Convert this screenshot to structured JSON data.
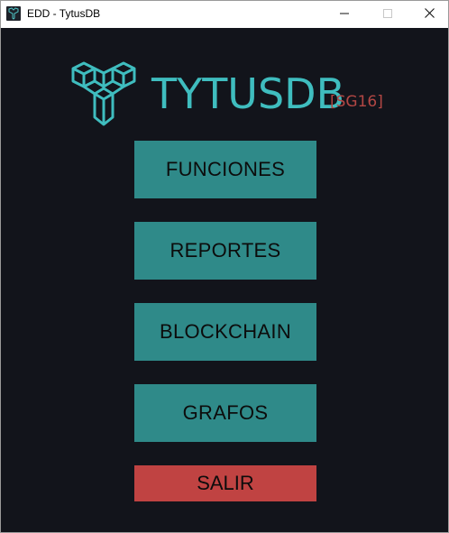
{
  "window": {
    "title": "EDD - TytusDB"
  },
  "logo": {
    "name": "TYTUSDB",
    "tag": "[SG16]"
  },
  "menu": {
    "functions_label": "FUNCIONES",
    "reports_label": "REPORTES",
    "blockchain_label": "BLOCKCHAIN",
    "graphs_label": "GRAFOS",
    "exit_label": "SALIR"
  },
  "colors": {
    "background": "#12141b",
    "button": "#2f8a89",
    "exit_button": "#c04342",
    "logo_accent": "#3fbdbf",
    "tag_color": "#b34744"
  },
  "icons": {
    "app": "tytus-logo-icon",
    "minimize": "minimize-icon",
    "maximize": "maximize-icon",
    "close": "close-icon"
  }
}
